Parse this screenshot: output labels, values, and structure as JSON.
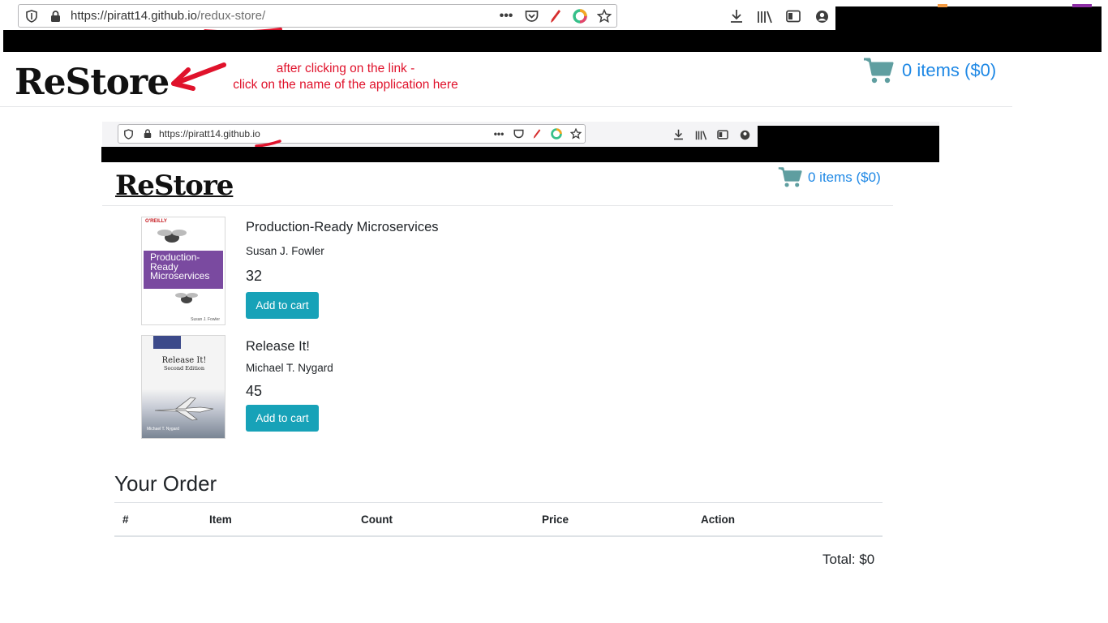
{
  "outer_browser": {
    "url_host": "https://piratt14.github.io",
    "url_path": "/redux-store/"
  },
  "outer_app": {
    "brand": "ReStore",
    "cart_text": "0 items ($0)"
  },
  "annotation": {
    "line1": "after clicking on the link -",
    "line2": "click on the name of the application here"
  },
  "inner_browser": {
    "url_host": "https://piratt14.github.io"
  },
  "inner_app": {
    "brand": "ReStore",
    "cart_text": "0 items ($0)",
    "books": [
      {
        "title": "Production-Ready Microservices",
        "author": "Susan J. Fowler",
        "price": "32",
        "button": "Add to cart",
        "cover": {
          "publisher": "O'REILLY",
          "line1": "Production-",
          "line2": "Ready",
          "line3": "Microservices",
          "author": "Susan J. Fowler"
        }
      },
      {
        "title": "Release It!",
        "author": "Michael T. Nygard",
        "price": "45",
        "button": "Add to cart",
        "cover": {
          "title": "Release It!",
          "subtitle": "Second Edition",
          "author": "Michael T. Nygard"
        }
      }
    ],
    "order": {
      "heading": "Your Order",
      "columns": [
        "#",
        "Item",
        "Count",
        "Price",
        "Action"
      ],
      "total": "Total: $0"
    }
  },
  "colors": {
    "accent": "#17a2b8",
    "cart_blue": "#1e88e5",
    "cart_icon": "#5f9ea0",
    "annotation_red": "#e0122b"
  }
}
